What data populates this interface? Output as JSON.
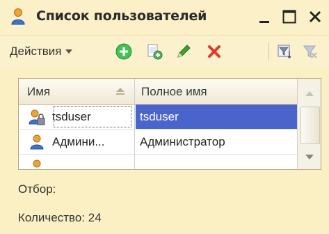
{
  "window": {
    "title": "Список пользователей",
    "icons": {
      "title": "user-icon",
      "minimize": "minimize-icon",
      "maximize": "maximize-icon",
      "close": "close-icon"
    }
  },
  "toolbar": {
    "actions_label": "Действия",
    "buttons": [
      {
        "name": "add",
        "icon": "add-icon",
        "color": "#3fbf4f"
      },
      {
        "name": "copy",
        "icon": "copy-icon",
        "color": "#6aa36a"
      },
      {
        "name": "edit",
        "icon": "edit-icon",
        "color": "#3a9a2a"
      },
      {
        "name": "delete",
        "icon": "delete-icon",
        "color": "#e03a2a"
      },
      {
        "name": "filter",
        "icon": "filter-icon",
        "color": "#5a6a8a"
      },
      {
        "name": "clear-filter",
        "icon": "clear-filter-icon",
        "color": "#b0b6c0"
      }
    ]
  },
  "table": {
    "columns": [
      "Имя",
      "Полное имя"
    ],
    "sort_icon": "sort-icon",
    "rows": [
      {
        "name": "tsduser",
        "full_name": "tsduser",
        "icon": "user-lock-icon",
        "selected": true
      },
      {
        "name": "Админи...",
        "full_name": "Администратор",
        "icon": "user-icon",
        "selected": false
      }
    ]
  },
  "footer": {
    "filter_label": "Отбор:",
    "count_label": "Количество: 24"
  }
}
